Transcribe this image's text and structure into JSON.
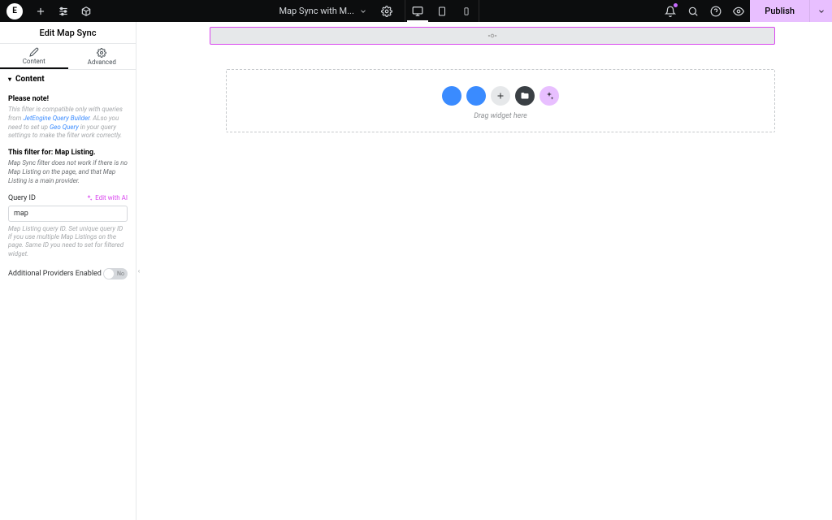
{
  "header": {
    "doc_title": "Map Sync with M...",
    "publish_label": "Publish"
  },
  "sidebar": {
    "panel_title": "Edit Map Sync",
    "tabs": {
      "content": "Content",
      "advanced": "Advanced"
    },
    "section_title": "Content",
    "please_note_title": "Please note!",
    "note_part1": "This filter is compatible only with queries from ",
    "note_link1": "JetEngine Query Builder",
    "note_part2": ". ALso you need to set up ",
    "note_link2": "Geo Query",
    "note_part3": " in your query settings to make the filter work correctly.",
    "filter_for_title": "This filter for: Map Listing.",
    "filter_for_desc": "Map Sync filter does not work if there is no Map Listing on the page, and that Map Listing is a main provider.",
    "query_id_label": "Query ID",
    "edit_ai_label": "Edit with AI",
    "query_id_value": "map",
    "query_id_help": "Map Listing query ID. Set unique query ID if you use multiple Map Listings on the page. Same ID you need to set for filtered widget.",
    "additional_label": "Additional Providers Enabled",
    "toggle_value": "No"
  },
  "canvas": {
    "dropzone_text": "Drag widget here"
  }
}
